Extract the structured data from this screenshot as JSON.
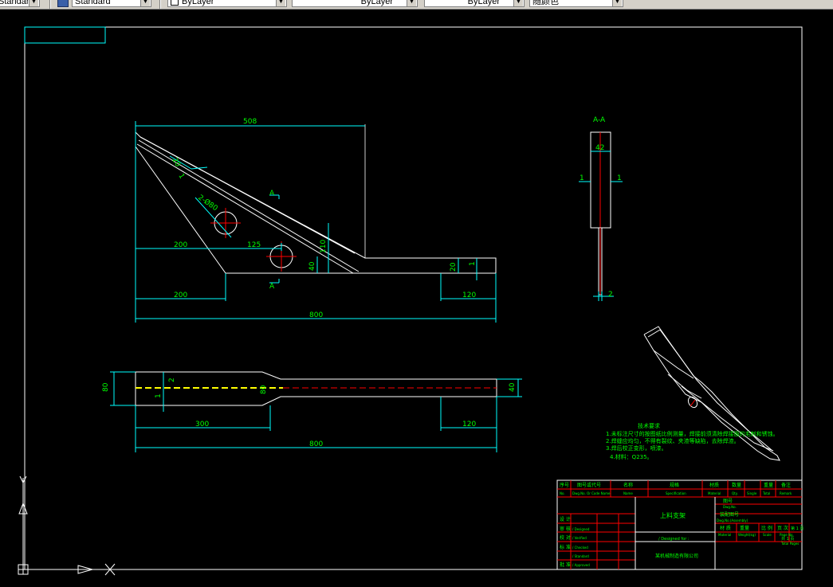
{
  "toolbar": {
    "combo_first": "Standard",
    "combo_textstyle": "Standard",
    "combo_color": "ByLayer",
    "combo_linetype": "ByLayer",
    "combo_lineweight": "ByLayer",
    "combo_plotstyle": "随颜色"
  },
  "drawing": {
    "dims": {
      "overall_top": "508",
      "thick_20": "20",
      "thick_1": "1",
      "holes": "2-Ø80",
      "left_200_a": "200",
      "pitch_125": "125",
      "h_110": "110",
      "h_40": "40",
      "h_20": "20",
      "h_1": "1",
      "left_200_b": "200",
      "right_120": "120",
      "overall_800": "800"
    },
    "section": {
      "label": "A-A",
      "w42": "42",
      "left1": "1",
      "right1": "1",
      "w2": "2"
    },
    "section_mark_top": "A",
    "section_mark_bottom": "A",
    "bottom_view": {
      "h80": "80",
      "d2": "2",
      "d1": "1",
      "r80": "80",
      "h40": "40",
      "w300": "300",
      "w120": "120",
      "w800": "800"
    },
    "notes": {
      "title": "技术要求",
      "line1": "1.未标注尺寸的按图纸比例测量，焊接前须清除焊接面的毛刺和锈蚀。",
      "line2": "2.焊缝应均匀，不得有裂纹、夹渣等缺陷，去除焊渣。",
      "line3": "3.焊后校正变形，喷漆。",
      "line4": "4.材料：Q235。"
    },
    "title_block": {
      "h_no": "序号",
      "h_code": "图号或代号",
      "h_name": "名称",
      "h_spec": "规格",
      "h_material": "材质",
      "h_qty": "数量",
      "h_weight": "重量",
      "h_remark": "备注",
      "e_no": "No.",
      "e_code": "Dwg.No. Or Code Name",
      "e_name": "Name",
      "e_spec": "Specification",
      "e_material": "Material",
      "e_qty": "Qty.",
      "e_single": "Single",
      "e_total": "Total",
      "e_remark": "Remark",
      "drawing_title": "上料支架",
      "dwg_no_cn": "图号",
      "dwg_no_en": "Dwg.No.",
      "assy_cn": "装配图号",
      "assy_en": "Dwg.No.(Assembly)",
      "weight_label": "Weight(kg)",
      "scale_label": "Scale",
      "page_label": "Page No.",
      "total_pages": "Total Pages",
      "sheet_of": "共 1 页",
      "sheet_no": "第 1 页",
      "r_designed": "设 计",
      "r_verified": "审 核",
      "r_checked": "校 对",
      "r_standard": "标 准",
      "r_approved": "批 准",
      "e_designed": "/ Designed",
      "e_verified": "/ Verified",
      "e_checked": "/ Checked",
      "e_standard": "/ Standard",
      "e_approved": "/ Approved",
      "project_label": "/ Designed for :",
      "project_name": "某机械制造有限公司",
      "material_cn": "材 质",
      "weight_cn": "重量",
      "scale_cn": "比 例",
      "page_cn": "页 次",
      "material_en": "Material"
    }
  }
}
